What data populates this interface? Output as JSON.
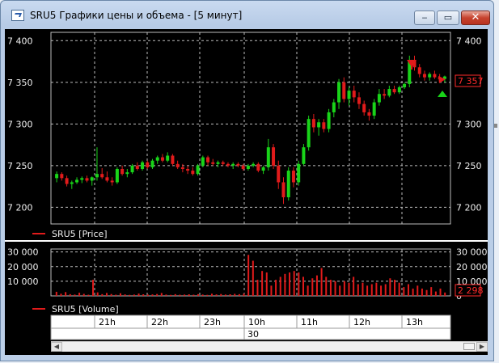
{
  "window": {
    "title": "SRU5 Графики цены и объема - [5 минут]",
    "buttons": {
      "minimize": "‒",
      "maximize": "▭",
      "close": "✕"
    }
  },
  "price_panel": {
    "y_ticks": [
      "7 400",
      "7 350",
      "7 300",
      "7 250",
      "7 200"
    ],
    "legend": "SRU5 [Price]",
    "last_price_label": "7 357",
    "colors": {
      "up": "#19d419",
      "down": "#e11b1b",
      "last_label": "#ff2a2a"
    }
  },
  "volume_panel": {
    "y_ticks": [
      "30 000",
      "20 000",
      "10 000",
      "0"
    ],
    "legend": "SRU5 [Volume]",
    "last_volume_label": "2 298"
  },
  "time_axis": {
    "hours": [
      "21h",
      "22h",
      "23h",
      "10h",
      "11h",
      "12h",
      "13h"
    ],
    "day": "30"
  },
  "chart_data": [
    {
      "type": "candlestick",
      "ylim": [
        7180,
        7410
      ],
      "y_ticks": [
        7400,
        7350,
        7300,
        7250,
        7200
      ],
      "series": [
        {
          "name": "SRU5 [Price]",
          "values": [
            [
              7235,
              7243,
              7230,
              7240
            ],
            [
              7240,
              7242,
              7232,
              7235
            ],
            [
              7235,
              7238,
              7225,
              7228
            ],
            [
              7228,
              7232,
              7222,
              7230
            ],
            [
              7230,
              7236,
              7228,
              7233
            ],
            [
              7233,
              7237,
              7229,
              7235
            ],
            [
              7235,
              7238,
              7230,
              7232
            ],
            [
              7232,
              7237,
              7226,
              7236
            ],
            [
              7236,
              7272,
              7232,
              7240
            ],
            [
              7240,
              7247,
              7234,
              7236
            ],
            [
              7236,
              7243,
              7230,
              7232
            ],
            [
              7232,
              7236,
              7226,
              7230
            ],
            [
              7230,
              7248,
              7228,
              7246
            ],
            [
              7246,
              7250,
              7238,
              7240
            ],
            [
              7240,
              7246,
              7236,
              7242
            ],
            [
              7242,
              7252,
              7240,
              7250
            ],
            [
              7250,
              7254,
              7244,
              7246
            ],
            [
              7246,
              7256,
              7244,
              7254
            ],
            [
              7254,
              7256,
              7246,
              7248
            ],
            [
              7248,
              7258,
              7246,
              7256
            ],
            [
              7256,
              7262,
              7252,
              7260
            ],
            [
              7260,
              7264,
              7254,
              7256
            ],
            [
              7256,
              7266,
              7254,
              7262
            ],
            [
              7262,
              7264,
              7250,
              7252
            ],
            [
              7252,
              7256,
              7246,
              7248
            ],
            [
              7248,
              7252,
              7242,
              7246
            ],
            [
              7246,
              7250,
              7240,
              7244
            ],
            [
              7244,
              7248,
              7238,
              7240
            ],
            [
              7240,
              7252,
              7238,
              7250
            ],
            [
              7250,
              7262,
              7248,
              7260
            ],
            [
              7260,
              7262,
              7250,
              7254
            ],
            [
              7254,
              7258,
              7250,
              7252
            ],
            [
              7252,
              7256,
              7248,
              7254
            ],
            [
              7254,
              7256,
              7250,
              7252
            ],
            [
              7252,
              7254,
              7248,
              7250
            ],
            [
              7250,
              7254,
              7246,
              7252
            ],
            [
              7252,
              7254,
              7248,
              7250
            ],
            [
              7250,
              7252,
              7244,
              7246
            ],
            [
              7246,
              7252,
              7244,
              7250
            ],
            [
              7250,
              7254,
              7248,
              7252
            ],
            [
              7252,
              7254,
              7242,
              7244
            ],
            [
              7244,
              7250,
              7240,
              7248
            ],
            [
              7248,
              7282,
              7244,
              7272
            ],
            [
              7272,
              7276,
              7246,
              7250
            ],
            [
              7250,
              7256,
              7222,
              7230
            ],
            [
              7230,
              7236,
              7204,
              7212
            ],
            [
              7212,
              7248,
              7208,
              7244
            ],
            [
              7244,
              7248,
              7224,
              7230
            ],
            [
              7230,
              7256,
              7226,
              7252
            ],
            [
              7252,
              7276,
              7250,
              7272
            ],
            [
              7272,
              7310,
              7268,
              7306
            ],
            [
              7306,
              7312,
              7290,
              7296
            ],
            [
              7296,
              7306,
              7286,
              7302
            ],
            [
              7302,
              7306,
              7290,
              7294
            ],
            [
              7294,
              7318,
              7290,
              7314
            ],
            [
              7314,
              7330,
              7308,
              7326
            ],
            [
              7326,
              7354,
              7318,
              7350
            ],
            [
              7350,
              7356,
              7326,
              7330
            ],
            [
              7330,
              7344,
              7322,
              7340
            ],
            [
              7340,
              7346,
              7326,
              7332
            ],
            [
              7332,
              7338,
              7318,
              7324
            ],
            [
              7324,
              7328,
              7310,
              7314
            ],
            [
              7314,
              7318,
              7304,
              7310
            ],
            [
              7310,
              7330,
              7306,
              7326
            ],
            [
              7326,
              7342,
              7322,
              7336
            ],
            [
              7336,
              7342,
              7330,
              7334
            ],
            [
              7334,
              7346,
              7332,
              7342
            ],
            [
              7342,
              7346,
              7336,
              7338
            ],
            [
              7338,
              7346,
              7336,
              7344
            ],
            [
              7344,
              7350,
              7342,
              7348
            ],
            [
              7348,
              7382,
              7344,
              7376
            ],
            [
              7376,
              7382,
              7364,
              7368
            ],
            [
              7368,
              7372,
              7356,
              7360
            ],
            [
              7360,
              7364,
              7352,
              7356
            ],
            [
              7356,
              7362,
              7352,
              7360
            ],
            [
              7360,
              7364,
              7354,
              7356
            ],
            [
              7356,
              7360,
              7350,
              7354
            ],
            [
              7354,
              7358,
              7350,
              7357
            ]
          ]
        }
      ]
    },
    {
      "type": "bar",
      "ylim": [
        0,
        32000
      ],
      "y_ticks": [
        30000,
        20000,
        10000,
        0
      ],
      "series": [
        {
          "name": "SRU5 [Volume]",
          "values": [
            2800,
            1500,
            2600,
            1200,
            900,
            2200,
            1400,
            800,
            11000,
            2400,
            1200,
            2000,
            1300,
            800,
            1800,
            1000,
            700,
            900,
            1600,
            1100,
            900,
            1000,
            1300,
            2000,
            900,
            700,
            1200,
            800,
            900,
            1100,
            800,
            1200,
            900,
            700,
            1500,
            1000,
            1300,
            900,
            1100,
            1400,
            1200,
            1600,
            28000,
            24000,
            11000,
            17000,
            16000,
            7000,
            11000,
            13000,
            15000,
            16000,
            17000,
            16000,
            13000,
            7000,
            12000,
            14000,
            19000,
            13000,
            11000,
            10000,
            7000,
            10000,
            9000,
            13000,
            8000,
            9000,
            7000,
            8000,
            9000,
            7000,
            8000,
            12000,
            11000,
            9000,
            6000,
            8000,
            5000,
            7000,
            5000,
            4000,
            6000,
            3000,
            5000,
            2298
          ]
        }
      ]
    }
  ]
}
